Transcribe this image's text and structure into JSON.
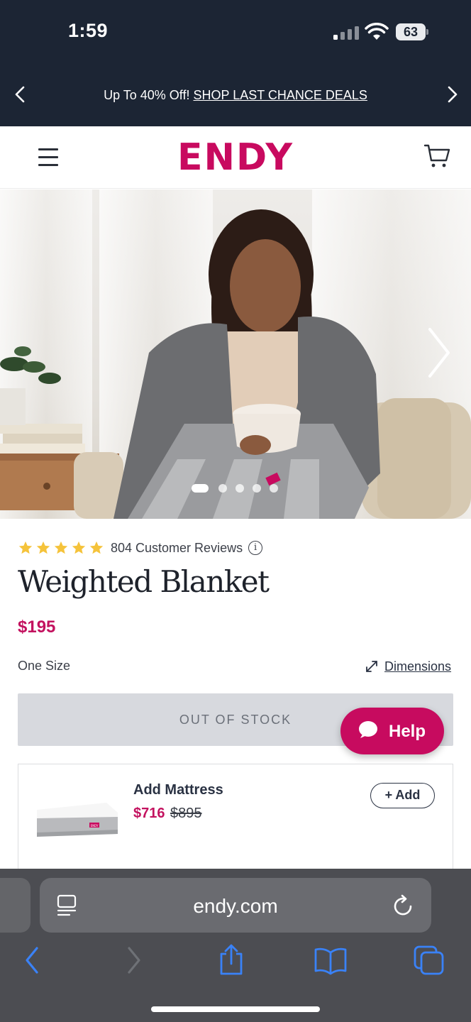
{
  "status_bar": {
    "time": "1:59",
    "battery": "63"
  },
  "promo": {
    "text": "Up To 40% Off!",
    "link": "SHOP LAST CHANCE DEALS"
  },
  "header": {
    "logo": "ENDY"
  },
  "hero": {
    "slide_count": 5,
    "active_slide": 1
  },
  "product": {
    "rating_stars": 5,
    "reviews": "804 Customer Reviews",
    "info_symbol": "i",
    "title": "Weighted Blanket",
    "price": "$195",
    "size": "One Size",
    "dimensions_link": "Dimensions",
    "stock_button": "OUT OF STOCK"
  },
  "help": {
    "label": "Help"
  },
  "addon": {
    "title": "Add Mattress",
    "price": "$716",
    "original_price": "$895",
    "button": "+ Add",
    "mattress_tag": "ENDY"
  },
  "browser": {
    "url": "endy.com"
  },
  "colors": {
    "brand": "#c80a5f",
    "dark": "#1c2534",
    "safari": "#4c4d52",
    "link_blue": "#3a82f7"
  },
  "icons": [
    "chevron-left-icon",
    "chevron-right-icon",
    "menu-icon",
    "cart-icon",
    "star-icon",
    "info-icon",
    "expand-icon",
    "chat-bubble-icon",
    "reader-icon",
    "reload-icon",
    "back-icon",
    "forward-icon",
    "share-icon",
    "bookmarks-icon",
    "tabs-icon"
  ]
}
